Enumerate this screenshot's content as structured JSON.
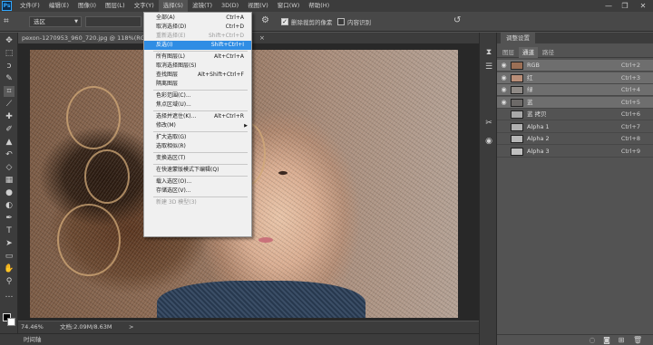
{
  "menubar": {
    "app_icon": "Ps",
    "items": [
      "文件(F)",
      "编辑(E)",
      "图像(I)",
      "图层(L)",
      "文字(Y)",
      "选择(S)",
      "滤镜(T)",
      "3D(D)",
      "视图(V)",
      "窗口(W)",
      "帮助(H)"
    ],
    "window_controls": [
      "—",
      "❐",
      "✕"
    ]
  },
  "options": {
    "mode_value": "选区",
    "check1_label": "删除裁剪的像素",
    "check2_label": "内容识别"
  },
  "document": {
    "tab_title": "pexon-1270953_960_720.jpg @ 118%(RGB/8#) *",
    "tab_close": "× ",
    "zoom": "74.46%",
    "doc_info": "文档:2.09M/8.63M",
    "arrow": ">"
  },
  "timeline": {
    "label": "时间轴"
  },
  "panel": {
    "title": "调整设置",
    "tabs": [
      "图层",
      "通道",
      "路径"
    ],
    "active_tab": 1,
    "channels": [
      {
        "name": "RGB",
        "key": "Ctrl+2",
        "eye": true,
        "selected": true,
        "thumb": "#9b6f55"
      },
      {
        "name": "红",
        "key": "Ctrl+3",
        "eye": true,
        "selected": true,
        "thumb": "#b98e78"
      },
      {
        "name": "绿",
        "key": "Ctrl+4",
        "eye": true,
        "selected": true,
        "thumb": "#8f8a86"
      },
      {
        "name": "蓝",
        "key": "Ctrl+5",
        "eye": true,
        "selected": true,
        "thumb": "#6d6a68"
      },
      {
        "name": "蓝 拷贝",
        "key": "Ctrl+6",
        "eye": false,
        "selected": false,
        "thumb": "#a8a8a8"
      },
      {
        "name": "Alpha 1",
        "key": "Ctrl+7",
        "eye": false,
        "selected": false,
        "thumb": "#b0b0b0"
      },
      {
        "name": "Alpha 2",
        "key": "Ctrl+8",
        "eye": false,
        "selected": false,
        "thumb": "#b8b8b8"
      },
      {
        "name": "Alpha 3",
        "key": "Ctrl+9",
        "eye": false,
        "selected": false,
        "thumb": "#c0c0c0"
      }
    ]
  },
  "select_menu": {
    "items": [
      {
        "label": "全部(A)",
        "key": "Ctrl+A",
        "state": "normal"
      },
      {
        "label": "取消选择(D)",
        "key": "Ctrl+D",
        "state": "normal"
      },
      {
        "label": "重新选择(E)",
        "key": "Shift+Ctrl+D",
        "state": "disabled"
      },
      {
        "label": "反选(I)",
        "key": "Shift+Ctrl+I",
        "state": "highlighted"
      },
      {
        "sep": true
      },
      {
        "label": "所有图层(L)",
        "key": "Alt+Ctrl+A",
        "state": "normal"
      },
      {
        "label": "取消选择图层(S)",
        "key": "",
        "state": "normal"
      },
      {
        "label": "查找图层",
        "key": "Alt+Shift+Ctrl+F",
        "state": "normal"
      },
      {
        "label": "隔离图层",
        "key": "",
        "state": "normal"
      },
      {
        "sep": true
      },
      {
        "label": "色彩范围(C)...",
        "key": "",
        "state": "normal"
      },
      {
        "label": "焦点区域(U)...",
        "key": "",
        "state": "normal"
      },
      {
        "sep": true
      },
      {
        "label": "选择并遮住(K)...",
        "key": "Alt+Ctrl+R",
        "state": "normal"
      },
      {
        "label": "修改(M)",
        "key": "",
        "state": "normal",
        "submenu": true
      },
      {
        "sep": true
      },
      {
        "label": "扩大选取(G)",
        "key": "",
        "state": "normal"
      },
      {
        "label": "选取相似(R)",
        "key": "",
        "state": "normal"
      },
      {
        "sep": true
      },
      {
        "label": "变换选区(T)",
        "key": "",
        "state": "normal"
      },
      {
        "sep": true
      },
      {
        "label": "在快速蒙版模式下编辑(Q)",
        "key": "",
        "state": "normal"
      },
      {
        "sep": true
      },
      {
        "label": "载入选区(O)...",
        "key": "",
        "state": "normal"
      },
      {
        "label": "存储选区(V)...",
        "key": "",
        "state": "normal"
      },
      {
        "sep": true
      },
      {
        "label": "新建 3D 模型(3)",
        "key": "",
        "state": "disabled"
      }
    ]
  },
  "colors": {
    "highlight": "#2f8de4",
    "ui_dark": "#3c3c3c",
    "ui_mid": "#535353"
  },
  "icons": {
    "left_toolbar": [
      "move-icon",
      "marquee-icon",
      "lasso-icon",
      "quick-select-icon",
      "crop-icon",
      "eyedropper-icon",
      "healing-brush-icon",
      "brush-icon",
      "clone-stamp-icon",
      "history-brush-icon",
      "eraser-icon",
      "gradient-icon",
      "blur-icon",
      "dodge-icon",
      "pen-icon",
      "type-icon",
      "path-select-icon",
      "rectangle-icon",
      "hand-icon",
      "zoom-icon",
      "more-tools-icon"
    ],
    "dock": [
      "history-icon",
      "properties-icon",
      "adjustments-icon",
      "tool-presets-icon"
    ],
    "panel_bottom": [
      "load-channel-selection-icon",
      "save-selection-icon",
      "new-channel-icon",
      "delete-channel-icon"
    ]
  }
}
